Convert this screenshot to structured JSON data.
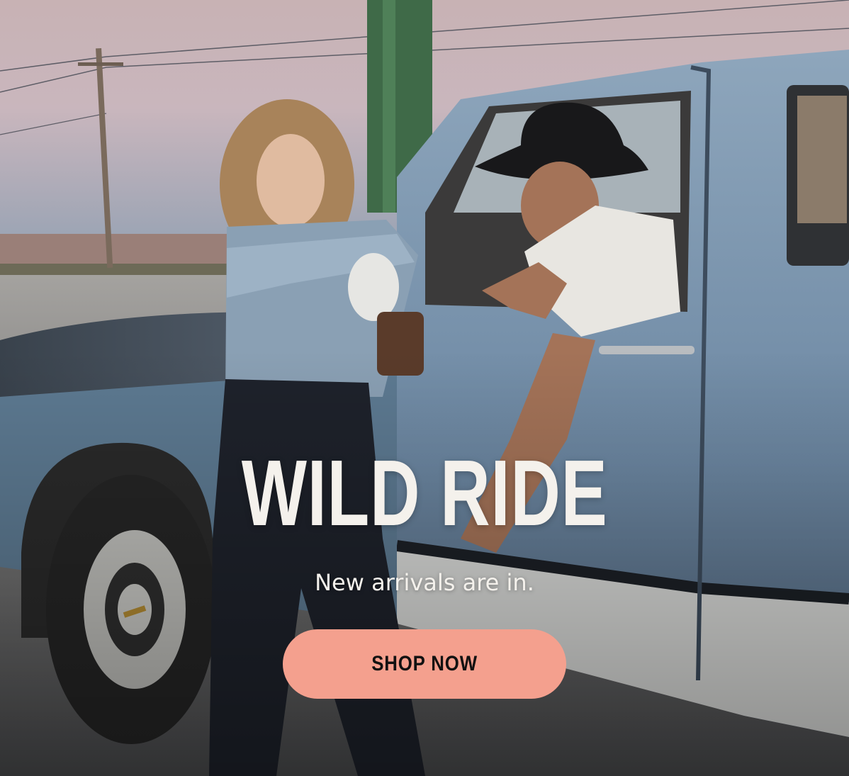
{
  "hero": {
    "headline": "WILD RIDE",
    "subheadline": "New arrivals are in.",
    "cta_label": "SHOP NOW",
    "image_alt": "Woman in denim leaning on a vintage blue pickup truck while a man in a cowboy hat sits in the driver's window at dusk"
  },
  "colors": {
    "cta_background": "#f4a08e",
    "cta_text": "#111111",
    "headline_text": "#f4f1ec",
    "sky_top": "#c9b3b2",
    "truck_blue": "#7f98b0"
  }
}
